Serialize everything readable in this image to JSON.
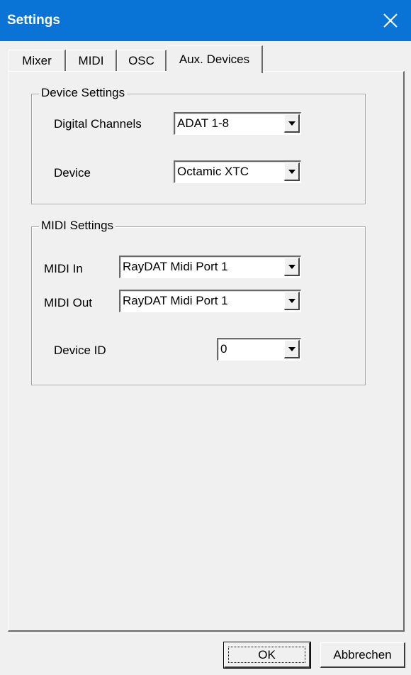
{
  "window": {
    "title": "Settings"
  },
  "tabs": [
    {
      "label": "Mixer"
    },
    {
      "label": "MIDI"
    },
    {
      "label": "OSC"
    },
    {
      "label": "Aux. Devices",
      "active": true
    }
  ],
  "device_settings": {
    "title": "Device Settings",
    "digital_channels": {
      "label": "Digital Channels",
      "value": "ADAT 1-8"
    },
    "device": {
      "label": "Device",
      "value": "Octamic XTC"
    }
  },
  "midi_settings": {
    "title": "MIDI Settings",
    "midi_in": {
      "label": "MIDI In",
      "value": "RayDAT Midi Port 1"
    },
    "midi_out": {
      "label": "MIDI Out",
      "value": "RayDAT Midi Port 1"
    },
    "device_id": {
      "label": "Device ID",
      "value": "0"
    }
  },
  "buttons": {
    "ok": "OK",
    "cancel": "Abbrechen"
  },
  "icons": {
    "close": "close-icon",
    "dropdown": "chevron-down-icon"
  },
  "colors": {
    "titlebar": "#0a74d6",
    "background": "#f0f0f0"
  }
}
